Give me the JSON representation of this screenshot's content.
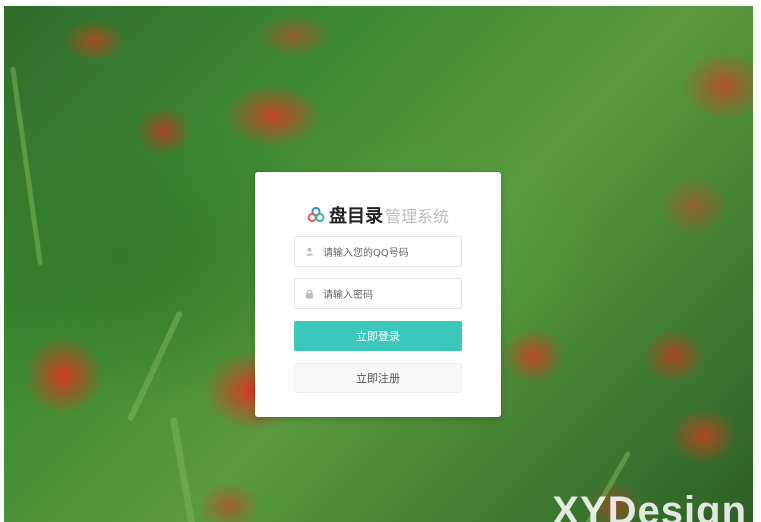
{
  "background": {
    "description_icon": "poppy-field-background",
    "watermark": "XYDesign"
  },
  "brand": {
    "icon": "three-circles-logo-icon",
    "name": "盘目录",
    "subtitle": "管理系统"
  },
  "form": {
    "qq_field": {
      "icon": "user-icon",
      "placeholder": "请输入您的QQ号码",
      "value": ""
    },
    "password_field": {
      "icon": "lock-icon",
      "placeholder": "请输入密码",
      "value": ""
    },
    "login_button": "立即登录",
    "register_button": "立即注册"
  },
  "colors": {
    "accent": "#3cc7bd",
    "card": "#ffffff"
  }
}
